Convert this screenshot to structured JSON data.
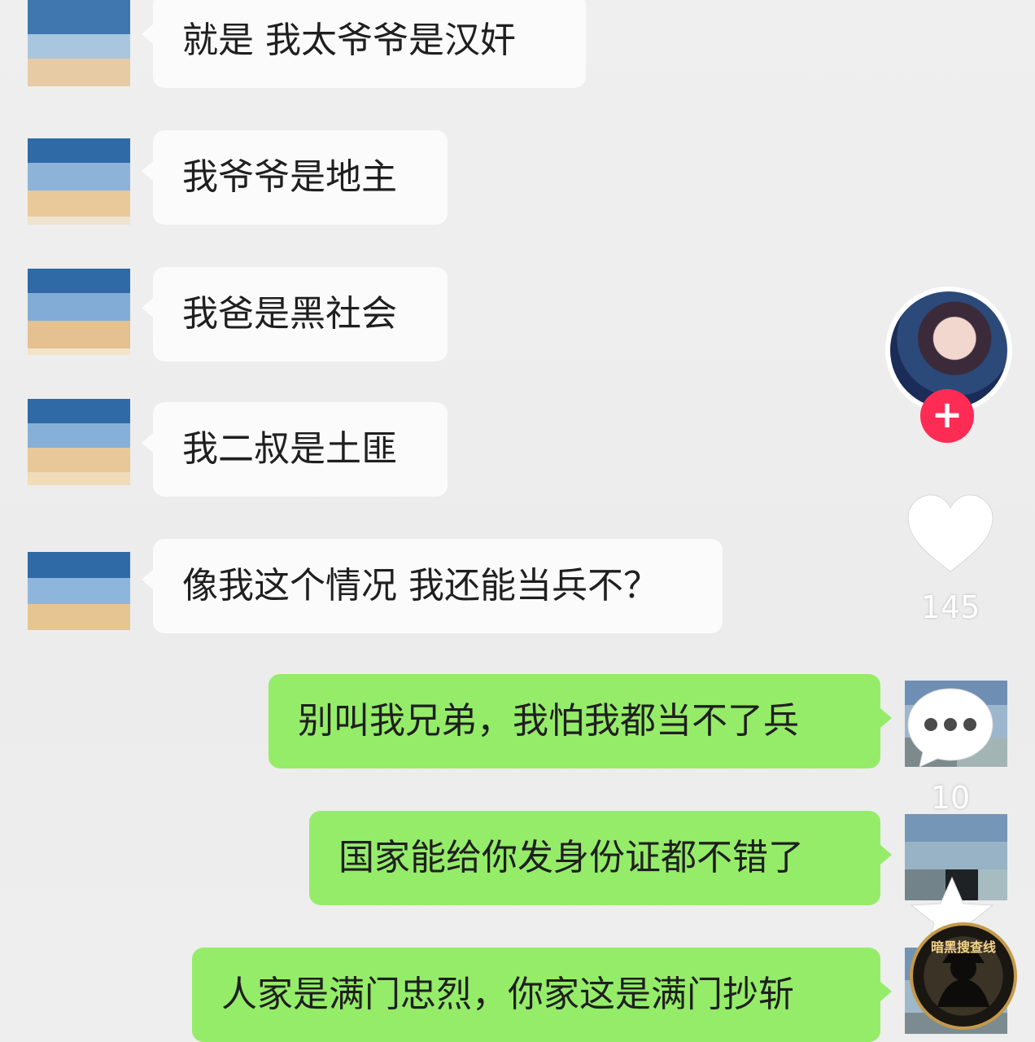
{
  "chat": {
    "messages": [
      {
        "side": "left",
        "text": "就是  我太爷爷是汉奸"
      },
      {
        "side": "left",
        "text": "我爷爷是地主"
      },
      {
        "side": "left",
        "text": "我爸是黑社会"
      },
      {
        "side": "left",
        "text": "我二叔是土匪"
      },
      {
        "side": "left",
        "text": "像我这个情况  我还能当兵不？"
      },
      {
        "side": "right",
        "text": "别叫我兄弟，我怕我都当不了兵"
      },
      {
        "side": "right",
        "text": "国家能给你发身份证都不错了"
      },
      {
        "side": "right",
        "text": "人家是满门忠烈，你家这是满门抄斩"
      }
    ]
  },
  "rail": {
    "follow_icon": "plus-icon",
    "follow_symbol": "+",
    "like_icon": "heart-icon",
    "like_count": "145",
    "comment_icon": "comment-bubble-icon",
    "comment_count": "10",
    "favorite_icon": "star-icon"
  },
  "watermark": {
    "text": "暗黑搜查线"
  },
  "colors": {
    "incoming_bubble": "#fbfbfb",
    "outgoing_bubble": "#95ec69",
    "follow_button": "#fe2c55"
  }
}
